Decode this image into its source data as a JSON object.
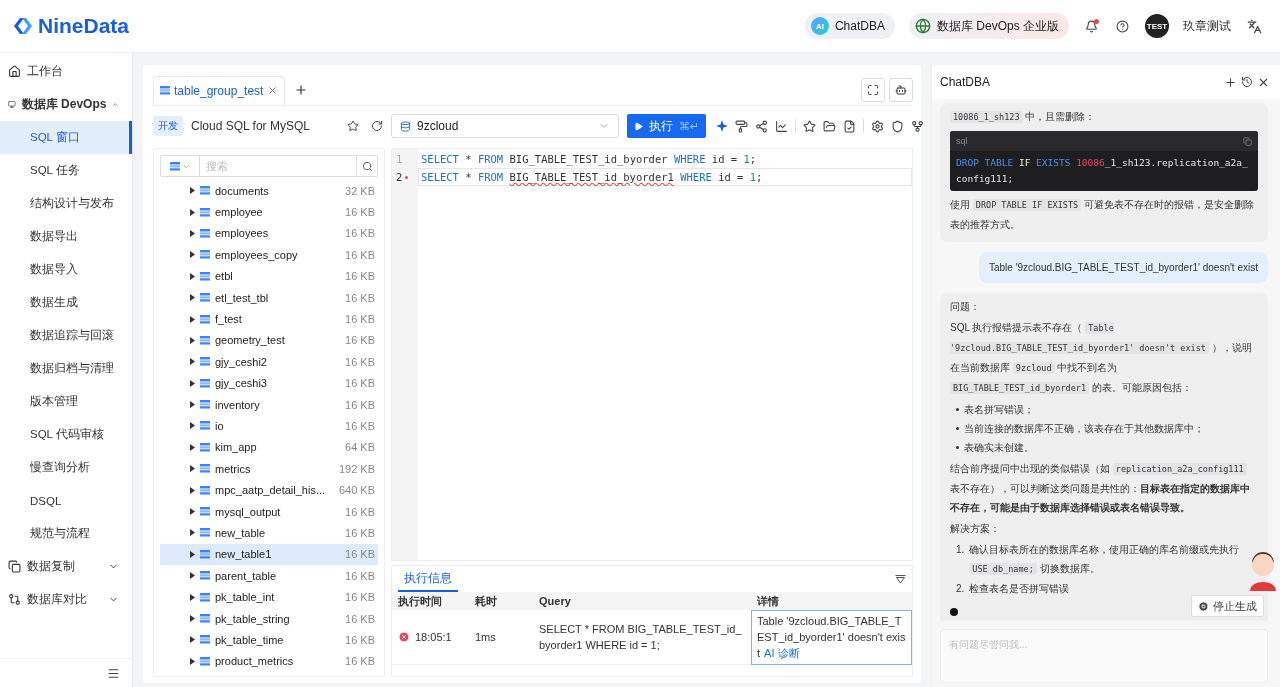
{
  "header": {
    "logo": "NineData",
    "chat_button": "ChatDBA",
    "chat_badge": "AI",
    "edition_button": "数据库 DevOps 企业版",
    "notification_dot": true,
    "avatar": "TEST",
    "user": "玖章测试"
  },
  "sidebar": {
    "items": [
      {
        "label": "工作台",
        "kind": "top",
        "selected": false
      },
      {
        "label": "数据库 DevOps",
        "kind": "group",
        "expanded": true,
        "children": [
          {
            "label": "SQL 窗口",
            "selected": true
          },
          {
            "label": "SQL 任务",
            "selected": false
          },
          {
            "label": "结构设计与发布",
            "selected": false
          },
          {
            "label": "数据导出",
            "selected": false
          },
          {
            "label": "数据导入",
            "selected": false
          },
          {
            "label": "数据生成",
            "selected": false
          },
          {
            "label": "数据追踪与回滚",
            "selected": false
          },
          {
            "label": "数据归档与清理",
            "selected": false
          },
          {
            "label": "版本管理",
            "selected": false
          },
          {
            "label": "SQL 代码审核",
            "selected": false
          },
          {
            "label": "慢查询分析",
            "selected": false
          },
          {
            "label": "DSQL",
            "selected": false
          },
          {
            "label": "规范与流程",
            "selected": false
          }
        ]
      },
      {
        "label": "数据复制",
        "kind": "group",
        "expanded": false
      },
      {
        "label": "数据库对比",
        "kind": "group",
        "expanded": false
      }
    ]
  },
  "workspace": {
    "tabs": [
      {
        "label": "table_group_test",
        "selected": true
      }
    ],
    "connection": {
      "env": "开发",
      "name": "Cloud SQL for MySQL"
    },
    "tree": {
      "search": {
        "placeholder": "搜索"
      },
      "rows": [
        {
          "name": "documents",
          "size": "32 KB",
          "selected": false
        },
        {
          "name": "employee",
          "size": "16 KB",
          "selected": false
        },
        {
          "name": "employees",
          "size": "16 KB",
          "selected": false
        },
        {
          "name": "employees_copy",
          "size": "16 KB",
          "selected": false
        },
        {
          "name": "etbl",
          "size": "16 KB",
          "selected": false
        },
        {
          "name": "etl_test_tbl",
          "size": "16 KB",
          "selected": false
        },
        {
          "name": "f_test",
          "size": "16 KB",
          "selected": false
        },
        {
          "name": "geometry_test",
          "size": "16 KB",
          "selected": false
        },
        {
          "name": "gjy_ceshi2",
          "size": "16 KB",
          "selected": false
        },
        {
          "name": "gjy_ceshi3",
          "size": "16 KB",
          "selected": false
        },
        {
          "name": "inventory",
          "size": "16 KB",
          "selected": false
        },
        {
          "name": "io",
          "size": "16 KB",
          "selected": false
        },
        {
          "name": "kim_app",
          "size": "64 KB",
          "selected": false
        },
        {
          "name": "metrics",
          "size": "192 KB",
          "selected": false
        },
        {
          "name": "mpc_aatp_detail_his...",
          "size": "640 KB",
          "selected": false
        },
        {
          "name": "mysql_output",
          "size": "16 KB",
          "selected": false
        },
        {
          "name": "new_table",
          "size": "16 KB",
          "selected": false
        },
        {
          "name": "new_table1",
          "size": "16 KB",
          "selected": true
        },
        {
          "name": "parent_table",
          "size": "16 KB",
          "selected": false
        },
        {
          "name": "pk_table_int",
          "size": "16 KB",
          "selected": false
        },
        {
          "name": "pk_table_string",
          "size": "16 KB",
          "selected": false
        },
        {
          "name": "pk_table_time",
          "size": "16 KB",
          "selected": false
        },
        {
          "name": "product_metrics",
          "size": "16 KB",
          "selected": false
        }
      ]
    },
    "database": "9zcloud",
    "run_button": {
      "label": "执行",
      "shortcut": "⌘↵"
    },
    "editor": {
      "lines": [
        {
          "number": "1",
          "error": false,
          "tokens": [
            {
              "text": "SELECT",
              "kind": "keyword"
            },
            {
              "text": " * ",
              "kind": "plain"
            },
            {
              "text": "FROM",
              "kind": "keyword"
            },
            {
              "text": " BIG_TABLE_TEST_id_byorder ",
              "kind": "plain"
            },
            {
              "text": "WHERE",
              "kind": "keyword"
            },
            {
              "text": " id = ",
              "kind": "plain"
            },
            {
              "text": "1",
              "kind": "number"
            },
            {
              "text": ";",
              "kind": "plain"
            }
          ]
        },
        {
          "number": "2",
          "error": true,
          "tokens": [
            {
              "text": "SELECT",
              "kind": "keyword"
            },
            {
              "text": " * ",
              "kind": "plain"
            },
            {
              "text": "FROM ",
              "kind": "keyword"
            },
            {
              "text": "BIG_TABLE_TEST_id_byorder1",
              "kind": "error"
            },
            {
              "text": " WHERE",
              "kind": "keyword"
            },
            {
              "text": " id = ",
              "kind": "plain"
            },
            {
              "text": "1",
              "kind": "number"
            },
            {
              "text": ";",
              "kind": "plain"
            }
          ]
        }
      ]
    },
    "results": {
      "tabs": [
        {
          "label": "执行信息",
          "selected": true
        }
      ],
      "columns": [
        "执行时间",
        "耗时",
        "Query",
        "详情"
      ],
      "rows": [
        {
          "failed": true,
          "time": "18:05:1",
          "duration": "1ms",
          "query": "SELECT * FROM BIG_TABLE_TEST_id_byorder1 WHERE id = 1;",
          "detail": "Table '9zcloud.BIG_TABLE_TEST_id_byorder1' doesn't exist",
          "detail_selected": true,
          "link": "AI 诊断"
        }
      ]
    }
  },
  "chat": {
    "title": "ChatDBA",
    "messages": [
      {
        "kind": "assistant",
        "blocks": [
          {
            "kind": "paragraph",
            "segments": [
              {
                "text": "10086_1_sh123",
                "kind": "code"
              },
              {
                "text": " 中，且需删除：",
                "kind": "plain"
              }
            ]
          },
          {
            "kind": "code",
            "lang": "sql",
            "tokens": [
              {
                "text": "DROP TABLE",
                "kind": "keyword"
              },
              {
                "text": " IF ",
                "kind": "plain"
              },
              {
                "text": "EXISTS ",
                "kind": "keyword"
              },
              {
                "text": "10086",
                "kind": "number"
              },
              {
                "text": "_1_sh123.replication_a2a_config111;",
                "kind": "plain"
              }
            ]
          },
          {
            "kind": "paragraph",
            "segments": [
              {
                "text": "使用 ",
                "kind": "plain"
              },
              {
                "text": "DROP TABLE IF EXISTS",
                "kind": "code"
              },
              {
                "text": " 可避免表不存在时的报错，是安全删除表的推荐方式。",
                "kind": "plain"
              }
            ]
          }
        ]
      },
      {
        "kind": "user",
        "blocks": [
          {
            "kind": "paragraph",
            "segments": [
              {
                "text": "Table '9zcloud.BIG_TABLE_TEST_id_byorder1' doesn't exist",
                "kind": "plain"
              }
            ]
          }
        ]
      },
      {
        "kind": "assistant",
        "typing": true,
        "blocks": [
          {
            "kind": "paragraph",
            "segments": [
              {
                "text": "问题：",
                "kind": "plain"
              }
            ]
          },
          {
            "kind": "paragraph",
            "segments": [
              {
                "text": "SQL 执行报错提示表不存在（ ",
                "kind": "plain"
              },
              {
                "text": "Table '9zcloud.BIG_TABLE_TEST_id_byorder1' doesn't exist",
                "kind": "code"
              },
              {
                "text": " ），说明在当前数据库 ",
                "kind": "plain"
              },
              {
                "text": "9zcloud",
                "kind": "code"
              },
              {
                "text": " 中找不到名为 ",
                "kind": "plain"
              },
              {
                "text": "BIG_TABLE_TEST_id_byorder1",
                "kind": "code"
              },
              {
                "text": " 的表。可能原因包括：",
                "kind": "plain"
              }
            ]
          },
          {
            "kind": "bullets",
            "items": [
              [
                {
                  "text": "表名拼写错误；",
                  "kind": "plain"
                }
              ],
              [
                {
                  "text": "当前连接的数据库不正确，该表存在于其他数据库中；",
                  "kind": "plain"
                }
              ],
              [
                {
                  "text": "表确实未创建。",
                  "kind": "plain"
                }
              ]
            ]
          },
          {
            "kind": "paragraph",
            "segments": [
              {
                "text": "结合前序提问中出现的类似错误（如 ",
                "kind": "plain"
              },
              {
                "text": "replication_a2a_config111",
                "kind": "code"
              },
              {
                "text": " 表不存在），可以判断这类问题是共性的：",
                "kind": "plain"
              },
              {
                "text": "目标表在指定的数据库中不存在，可能是由于数据库选择错误或表名错误导致。",
                "kind": "bold"
              }
            ]
          },
          {
            "kind": "paragraph",
            "segments": [
              {
                "text": "解决方案：",
                "kind": "plain"
              }
            ]
          },
          {
            "kind": "numbered",
            "items": [
              {
                "number": "1.",
                "segments": [
                  {
                    "text": "确认目标表所在的数据库名称，使用正确的库名前缀或先执行 ",
                    "kind": "plain"
                  },
                  {
                    "text": "USE db_name;",
                    "kind": "code"
                  },
                  {
                    "text": " 切换数据库。",
                    "kind": "plain"
                  }
                ]
              },
              {
                "number": "2.",
                "segments": [
                  {
                    "text": "检查表名是否拼写错误",
                    "kind": "plain"
                  }
                ]
              }
            ]
          }
        ]
      }
    ],
    "stop_button": "停止生成",
    "input": {
      "placeholder": "有问题尽管问我..."
    }
  }
}
